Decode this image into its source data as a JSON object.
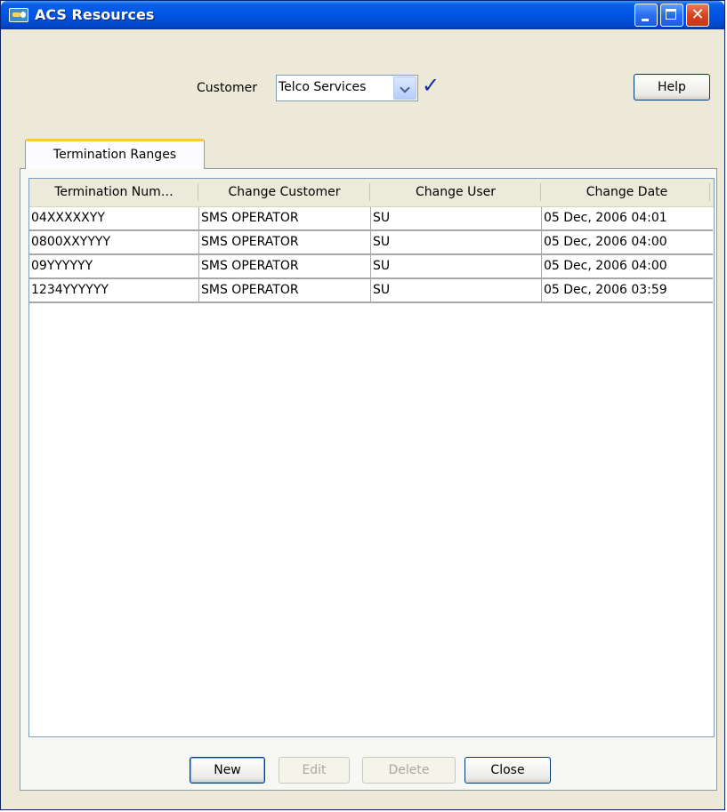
{
  "window": {
    "title": "ACS Resources",
    "close_glyph": "✕"
  },
  "customer": {
    "label": "Customer",
    "value": "Telco Services",
    "confirm_glyph": "✓"
  },
  "help_button": "Help",
  "tabs": [
    {
      "label": "Termination Ranges",
      "active": true
    }
  ],
  "table": {
    "columns": [
      "Termination Num…",
      "Change Customer",
      "Change User",
      "Change Date"
    ],
    "rows": [
      [
        "04XXXXXYY",
        "SMS OPERATOR",
        "SU",
        "05 Dec, 2006 04:01"
      ],
      [
        "0800XXYYYY",
        "SMS OPERATOR",
        "SU",
        "05 Dec, 2006 04:00"
      ],
      [
        "09YYYYYY",
        "SMS OPERATOR",
        "SU",
        "05 Dec, 2006 04:00"
      ],
      [
        "1234YYYYYY",
        "SMS OPERATOR",
        "SU",
        "05 Dec, 2006 03:59"
      ]
    ]
  },
  "buttons": {
    "new": "New",
    "edit": "Edit",
    "delete": "Delete",
    "close": "Close"
  },
  "icons": {
    "app": "key-icon",
    "minimize": "minimize-icon",
    "maximize": "maximize-icon",
    "close": "close-icon",
    "dropdown": "chevron-down-icon",
    "confirm": "checkmark-icon"
  }
}
